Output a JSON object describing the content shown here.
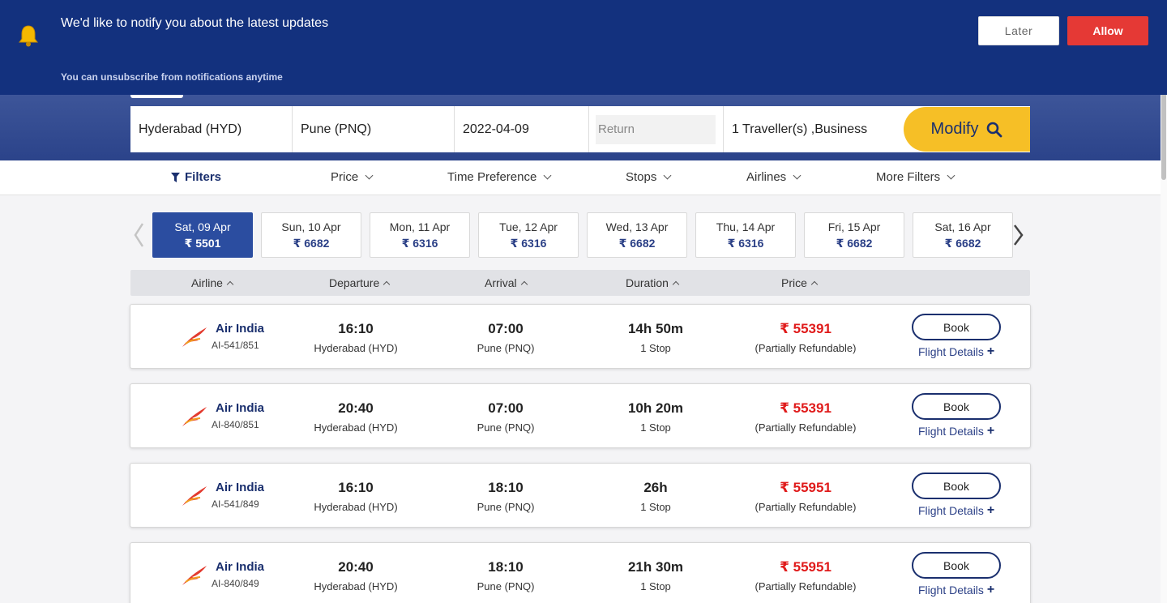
{
  "notification": {
    "title": "We'd like to notify you about the latest updates",
    "subtitle": "You can unsubscribe from notifications anytime",
    "later_label": "Later",
    "allow_label": "Allow",
    "bg_color": "#13317e",
    "allow_color": "#e53935"
  },
  "search": {
    "from": "Hyderabad (HYD)",
    "to": "Pune (PNQ)",
    "depart_date": "2022-04-09",
    "return_placeholder": "Return",
    "travellers": "1  Traveller(s) ,Business",
    "modify_label": "Modify",
    "modify_color": "#f6bf26"
  },
  "filters": {
    "filters_label": "Filters",
    "price_label": "Price",
    "time_label": "Time Preference",
    "stops_label": "Stops",
    "airlines_label": "Airlines",
    "more_label": "More Filters"
  },
  "dates": [
    {
      "day": "Sat, 09 Apr",
      "price": "₹ 5501",
      "active": true
    },
    {
      "day": "Sun, 10 Apr",
      "price": "₹ 6682"
    },
    {
      "day": "Mon, 11 Apr",
      "price": "₹ 6316"
    },
    {
      "day": "Tue, 12 Apr",
      "price": "₹ 6316"
    },
    {
      "day": "Wed, 13 Apr",
      "price": "₹ 6682"
    },
    {
      "day": "Thu, 14 Apr",
      "price": "₹ 6316"
    },
    {
      "day": "Fri, 15 Apr",
      "price": "₹ 6682"
    },
    {
      "day": "Sat, 16 Apr",
      "price": "₹ 6682"
    }
  ],
  "table_header": {
    "airline": "Airline",
    "departure": "Departure",
    "arrival": "Arrival",
    "duration": "Duration",
    "price": "Price"
  },
  "flights": [
    {
      "airline": "Air India",
      "code": "AI-541/851",
      "dep_time": "16:10",
      "dep_city": "Hyderabad (HYD)",
      "arr_time": "07:00",
      "arr_city": "Pune (PNQ)",
      "duration": "14h 50m",
      "stops": "1 Stop",
      "price": "₹ 55391",
      "refund": "(Partially Refundable)",
      "book": "Book",
      "details": "Flight Details"
    },
    {
      "airline": "Air India",
      "code": "AI-840/851",
      "dep_time": "20:40",
      "dep_city": "Hyderabad (HYD)",
      "arr_time": "07:00",
      "arr_city": "Pune (PNQ)",
      "duration": "10h 20m",
      "stops": "1 Stop",
      "price": "₹ 55391",
      "refund": "(Partially Refundable)",
      "book": "Book",
      "details": "Flight Details"
    },
    {
      "airline": "Air India",
      "code": "AI-541/849",
      "dep_time": "16:10",
      "dep_city": "Hyderabad (HYD)",
      "arr_time": "18:10",
      "arr_city": "Pune (PNQ)",
      "duration": "26h",
      "stops": "1 Stop",
      "price": "₹ 55951",
      "refund": "(Partially Refundable)",
      "book": "Book",
      "details": "Flight Details"
    },
    {
      "airline": "Air India",
      "code": "AI-840/849",
      "dep_time": "20:40",
      "dep_city": "Hyderabad (HYD)",
      "arr_time": "18:10",
      "arr_city": "Pune (PNQ)",
      "duration": "21h 30m",
      "stops": "1 Stop",
      "price": "₹ 55951",
      "refund": "(Partially Refundable)",
      "book": "Book",
      "details": "Flight Details"
    }
  ],
  "icons": {
    "notification": "bell-icon",
    "modify": "search-icon",
    "filter": "funnel-icon",
    "airline_logo": "air-india-logo",
    "prev": "chevron-left-icon",
    "next": "chevron-right-icon"
  }
}
